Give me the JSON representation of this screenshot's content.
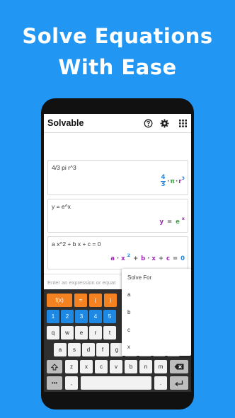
{
  "headline": {
    "line1": "Solve Equations",
    "line2": "With Ease"
  },
  "app": {
    "title": "Solvable",
    "icons": [
      "help-icon",
      "gear-icon",
      "grid-icon"
    ]
  },
  "cards": [
    {
      "expr": "4/3 pi r^3",
      "result": {
        "frac_num": "4",
        "frac_den": "3",
        "dot1": "·",
        "pi": "π",
        "dot2": "·",
        "r": "r",
        "exp": "3"
      }
    },
    {
      "expr": "y = e^x",
      "result": {
        "y": "y",
        "eq": "=",
        "e": "e",
        "exp": "x"
      }
    },
    {
      "expr": "a x^2 + b x + c = 0",
      "result": {
        "a": "a",
        "d1": "·",
        "x": "x",
        "exp": "2",
        "p1": "+",
        "b": "b",
        "d2": "·",
        "x2": "x",
        "p2": "+",
        "c": "c",
        "eq": "=",
        "zero": "0"
      }
    }
  ],
  "input": {
    "placeholder": "Enter an expression or equat"
  },
  "dropdown": {
    "title": "Solve For",
    "options": [
      "a",
      "b",
      "c",
      "x"
    ]
  },
  "keyboard": {
    "row_func": [
      "f(x)",
      "=",
      "(",
      ")"
    ],
    "row_num": [
      "1",
      "2",
      "3",
      "4",
      "5"
    ],
    "row_q": [
      "q",
      "w",
      "e",
      "r",
      "t"
    ],
    "row_a": [
      "a",
      "s",
      "d",
      "f",
      "g",
      "h",
      "j",
      "k",
      "l"
    ],
    "row_z": [
      "z",
      "x",
      "c",
      "v",
      "b",
      "n",
      "m"
    ],
    "row_bottom": {
      "symbols": "•••",
      "comma": ",",
      "period": "."
    }
  },
  "colors": {
    "background": "#2196f3",
    "orange_key": "#f58220",
    "blue_key": "#1e88e5",
    "math_blue": "#1e88e5",
    "math_green": "#43a047",
    "math_purple": "#9c27b0",
    "math_gray": "#555555"
  }
}
